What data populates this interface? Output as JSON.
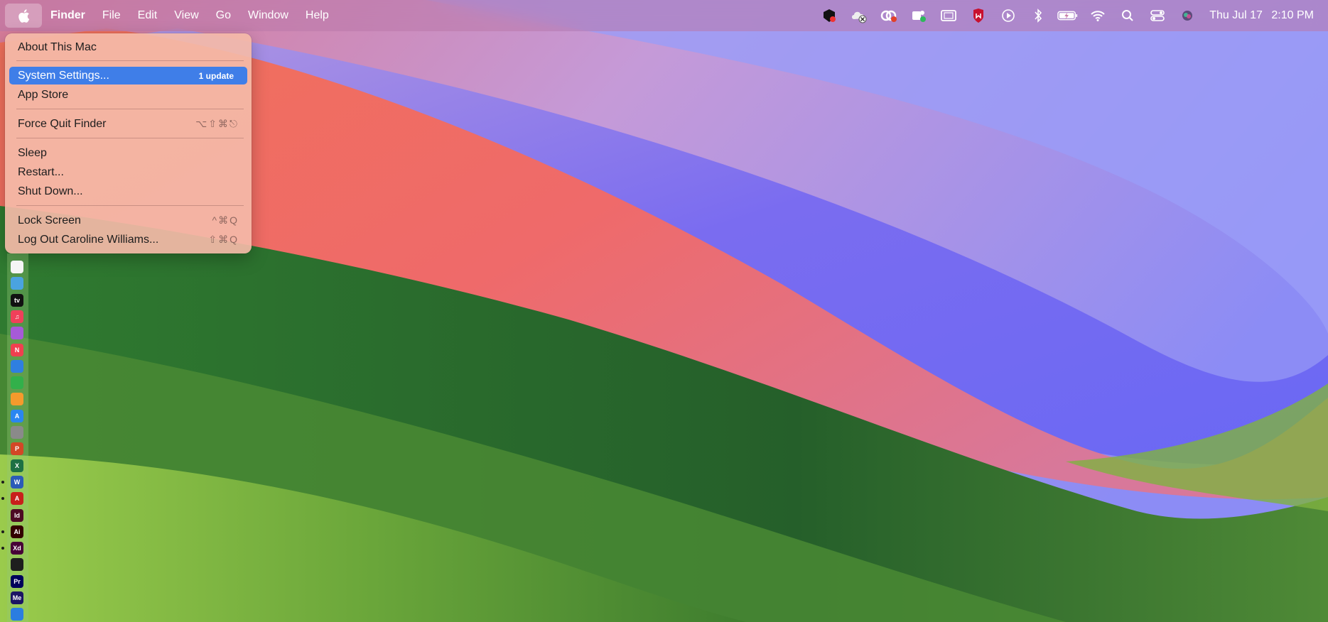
{
  "menubar": {
    "app_name": "Finder",
    "menus": [
      "File",
      "Edit",
      "View",
      "Go",
      "Window",
      "Help"
    ],
    "status_icons": [
      "privacy-shield-icon",
      "cloud-sync-icon",
      "creative-cloud-icon",
      "teams-icon",
      "screen-mirror-icon",
      "mcafee-icon",
      "play-icon",
      "bluetooth-icon",
      "battery-icon",
      "wifi-icon",
      "search-icon",
      "control-center-icon",
      "siri-icon"
    ],
    "clock_date": "Thu Jul 17",
    "clock_time": "2:10 PM"
  },
  "apple_menu": {
    "about": "About This Mac",
    "system_settings": "System Settings...",
    "system_settings_badge": "1 update",
    "app_store": "App Store",
    "force_quit": "Force Quit Finder",
    "force_quit_shortcut": "⌥⇧⌘⎋",
    "sleep": "Sleep",
    "restart": "Restart...",
    "shut_down": "Shut Down...",
    "lock_screen": "Lock Screen",
    "lock_screen_shortcut": "^⌘Q",
    "log_out": "Log Out Caroline Williams...",
    "log_out_shortcut": "⇧⌘Q"
  },
  "dock": {
    "apps": [
      {
        "name": "notes-icon",
        "label": "",
        "color": "#f5f5f5"
      },
      {
        "name": "freeform-icon",
        "label": "",
        "color": "#4aa3e0"
      },
      {
        "name": "apple-tv-icon",
        "label": "tv",
        "color": "#111111"
      },
      {
        "name": "music-icon",
        "label": "♫",
        "color": "#f0405a"
      },
      {
        "name": "podcasts-icon",
        "label": "",
        "color": "#a65ad8"
      },
      {
        "name": "news-icon",
        "label": "N",
        "color": "#f0404f"
      },
      {
        "name": "keynote-icon",
        "label": "",
        "color": "#2f7fe0"
      },
      {
        "name": "numbers-icon",
        "label": "",
        "color": "#32b04a"
      },
      {
        "name": "pages-icon",
        "label": "",
        "color": "#f59a2c"
      },
      {
        "name": "app-store-icon",
        "label": "A",
        "color": "#2a86f0"
      },
      {
        "name": "system-settings-icon",
        "label": "",
        "color": "#8a8a8a"
      },
      {
        "name": "powerpoint-icon",
        "label": "P",
        "color": "#d24726"
      },
      {
        "name": "excel-icon",
        "label": "X",
        "color": "#1d7044"
      },
      {
        "name": "word-icon",
        "label": "W",
        "color": "#2b5bb8"
      },
      {
        "name": "acrobat-icon",
        "label": "A",
        "color": "#c8201b"
      },
      {
        "name": "indesign-icon",
        "label": "Id",
        "color": "#4d0a23"
      },
      {
        "name": "illustrator-icon",
        "label": "Ai",
        "color": "#330000"
      },
      {
        "name": "xd-icon",
        "label": "Xd",
        "color": "#470137"
      },
      {
        "name": "figma-icon",
        "label": "",
        "color": "#1e1e1e"
      },
      {
        "name": "premiere-icon",
        "label": "Pr",
        "color": "#00005b"
      },
      {
        "name": "media-encoder-icon",
        "label": "Me",
        "color": "#1b1464"
      },
      {
        "name": "onedrive-icon",
        "label": "",
        "color": "#2b7de0"
      }
    ]
  }
}
